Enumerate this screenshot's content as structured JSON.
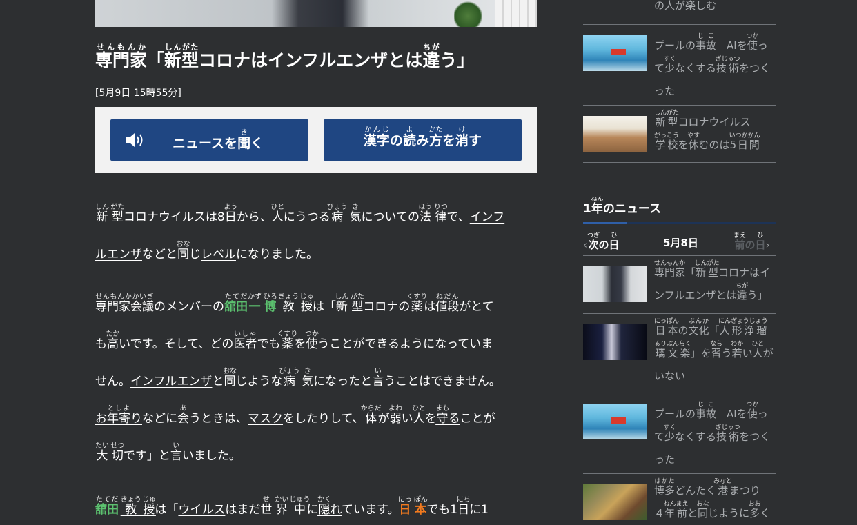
{
  "article": {
    "title": {
      "w1": "専門家",
      "w1_r": "せんもんか",
      "q1": "「",
      "w2": "新型",
      "w2_r": "しんがた",
      "mid": "コロナはインフルエンザとは",
      "w3": "違",
      "w3_r": "ちが",
      "end": "う」"
    },
    "date": "[5月9日 15時55分]"
  },
  "buttons": {
    "listen": {
      "pre": "ニュースを",
      "kanji": "聞",
      "ruby": "き",
      "post": "く"
    },
    "hide": {
      "k1": "漢字",
      "r1": "かんじ",
      "s1": "の",
      "k2": "読",
      "r2": "よ",
      "s2": "み",
      "k3": "方",
      "r3": "かた",
      "s3": "を",
      "k4": "消",
      "r4": "け",
      "s4": "す"
    }
  },
  "body": {
    "p1l1": {
      "a": "新",
      "ar": "しん",
      "b": "型",
      "br": "がた",
      "c": "コロナウイルスは8",
      "d": "日",
      "dr": "よう",
      "e": "から、",
      "f": "人",
      "fr": "ひと",
      "g": "にうつる",
      "h": "病",
      "hr": "びょう",
      "i": "気",
      "ir": "き",
      "j": "についての",
      "k": "法",
      "kr": "ほう",
      "l": "律",
      "lr": "りつ",
      "m": "で、",
      "n": "インフ"
    },
    "p1l2": {
      "a": "ルエンザ",
      "b": "などと",
      "c": "同",
      "cr": "おな",
      "d": "じ",
      "e": "レベル",
      "f": "になりました。"
    },
    "p2l1": {
      "a": "専門家会議",
      "ar": "せんもんかかいぎ",
      "b": "の",
      "c": "メンバー",
      "d": "の",
      "e": "舘田",
      "er": "たてだ",
      "f": "一",
      "fr": "かず",
      "g": "博",
      "gr": "ひろ",
      "h": "教",
      "hr": "きょう",
      "i": "授",
      "ir": "じゅ",
      "j": "は「",
      "k": "新",
      "kr": "しん",
      "l": "型",
      "lr": "がた",
      "m": "コロナの",
      "n": "薬",
      "nr": "くすり",
      "o": "は",
      "p": "値段",
      "pr": "ねだん",
      "q": "がとて"
    },
    "p2l2": {
      "a": "も",
      "b": "高",
      "br": "たか",
      "c": "いです。そして、どの",
      "d": "医者",
      "dr": "いしゃ",
      "e": "でも",
      "f": "薬",
      "fr": "くすり",
      "g": "を",
      "h": "使",
      "hr": "つか",
      "i": "うことができるようになっていま"
    },
    "p2l3": {
      "a": "せん。",
      "b": "インフルエンザ",
      "c": "と",
      "d": "同",
      "dr": "おな",
      "e": "じような",
      "f": "病",
      "fr": "びょう",
      "g": "気",
      "gr": "き",
      "h": "になったと",
      "i": "言",
      "ir": "い",
      "j": "うことはできません。"
    },
    "p2l4": {
      "a": "お",
      "b": "年寄",
      "br": "としよ",
      "c": "り",
      "d": "などに",
      "e": "会",
      "er": "あ",
      "f": "うときは、",
      "g": "マスク",
      "h": "をしたりして、",
      "i": "体",
      "ir": "からだ",
      "j": "が",
      "k": "弱",
      "kr": "よわ",
      "l": "い",
      "m": "人",
      "mr": "ひと",
      "n": "を",
      "o": "守",
      "or": "まも",
      "p": "る",
      "q": "ことが"
    },
    "p2l5": {
      "a": "大",
      "ar": "たい",
      "b": "切",
      "br": "せつ",
      "c": "です」と",
      "d": "言",
      "dr": "い",
      "e": "いました。"
    },
    "p3l1": {
      "a": "舘田",
      "ar": "たてだ",
      "b": "教",
      "br": "きょう",
      "c": "授",
      "cr": "じゅ",
      "d": "は「",
      "e": "ウイルス",
      "f": "はまだ",
      "g": "世",
      "gr": "せ",
      "h": "界",
      "hr": "かい",
      "i": "中",
      "ir": "じゅう",
      "j": "に",
      "k": "隠",
      "kr": "かく",
      "l": "れ",
      "m": "ています。",
      "n": "日",
      "nr": "にっ",
      "o": "本",
      "or": "ぽん",
      "p": "でも1",
      "q": "日",
      "qr": "にち",
      "r": "に1"
    }
  },
  "sidebar": {
    "top_item": {
      "k1": "人",
      "r1": "ひと",
      "s1": "が",
      "k2": "楽",
      "r2": "たの",
      "s2": "しむ",
      "pre": "の"
    },
    "items_a": [
      {
        "l1": "プールの",
        "k1": "事故",
        "r1": "じこ",
        "l1b": "　AIを",
        "k2": "使",
        "r2": "つか",
        "l1c": "っ",
        "l2": "て",
        "k3": "少",
        "r3": "すく",
        "l2b": "なくする",
        "k4": "技術",
        "r4": "ぎじゅつ",
        "l2c": "をつく",
        "l3": "った"
      },
      {
        "k1": "新型",
        "r1": "しんがた",
        "l1": "コロナウイルス",
        "k2": "学校",
        "r2": "がっこう",
        "l2": "を",
        "k3": "休",
        "r3": "やす",
        "l2b": "むのは",
        "k4": "5日間",
        "r4": "いつかかん"
      }
    ],
    "section": {
      "pre": "1",
      "kanji": "年",
      "ruby": "ねん",
      "post": "のニュース"
    },
    "nav": {
      "prev_k": "次",
      "prev_r": "つぎ",
      "prev_s1": "の",
      "prev_k2": "日",
      "prev_r2": "ひ",
      "date": "5月8日",
      "next_k": "前",
      "next_r": "まえ",
      "next_s1": "の",
      "next_k2": "日",
      "next_r2": "ひ"
    },
    "items_b": [
      {
        "k1": "専門家",
        "r1": "せんもんか",
        "l1": "「",
        "k2": "新型",
        "r2": "しんがた",
        "l1b": "コロナはイ",
        "l2": "ンフルエンザとは",
        "k3": "違",
        "r3": "ちが",
        "l2b": "う」"
      },
      {
        "k1": "日本",
        "r1": "にっぽん",
        "l1": "の",
        "k2": "文化",
        "r2": "ぶんか",
        "l1b": "「",
        "k3": "人形浄瑠璃",
        "r3": "にんぎょうじょうるり",
        "k4": "文楽",
        "r4": "ぶんらく",
        "l2": "」を",
        "k5": "習",
        "r5": "なら",
        "l2b": "う",
        "k6": "若",
        "r6": "わか",
        "l2c": "い",
        "k7": "人",
        "r7": "ひと",
        "l2d": "がい",
        "l3": "ない"
      },
      {
        "l1": "プールの",
        "k1": "事故",
        "r1": "じこ",
        "l1b": "　AIを",
        "k2": "使",
        "r2": "つか",
        "l1c": "っ",
        "l2": "て",
        "k3": "少",
        "r3": "すく",
        "l2b": "なくする",
        "k4": "技術",
        "r4": "ぎじゅつ",
        "l2c": "をつく",
        "l3": "った"
      },
      {
        "k1": "博多",
        "r1": "はかた",
        "l1": "どんたく",
        "k2": "港",
        "r2": "みなと",
        "l1b": "まつり",
        "l2": "４",
        "k3": "年前",
        "r3": "ねんまえ",
        "l2b": "と",
        "k4": "同",
        "r4": "おな",
        "l2c": "じように",
        "k5": "多",
        "r5": "おお",
        "l2d": "く"
      }
    ]
  }
}
